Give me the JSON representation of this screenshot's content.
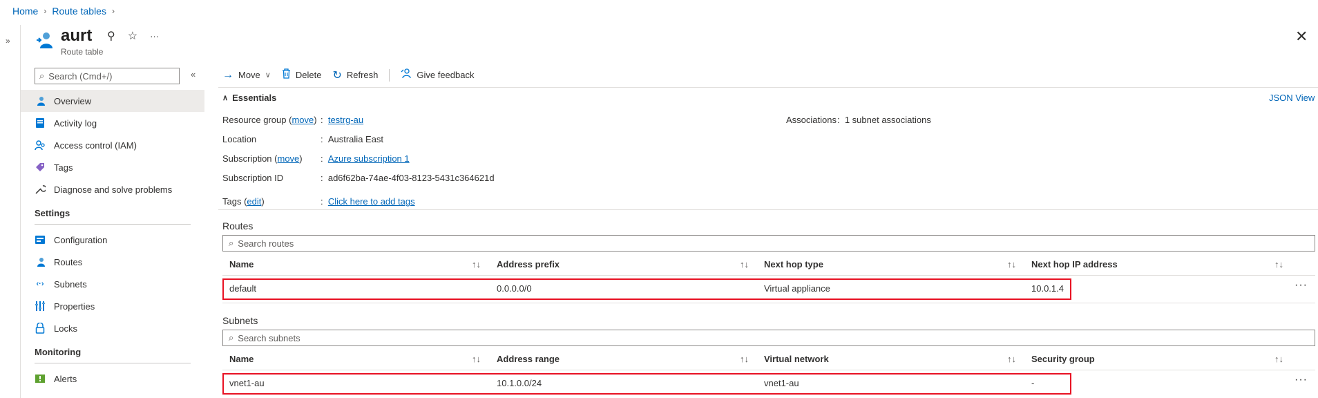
{
  "breadcrumb": {
    "home": "Home",
    "route_tables": "Route tables"
  },
  "resource": {
    "name": "aurt",
    "type": "Route table"
  },
  "menu": {
    "search_placeholder": "Search (Cmd+/)",
    "top_items": [
      "Overview",
      "Activity log",
      "Access control (IAM)",
      "Tags",
      "Diagnose and solve problems"
    ],
    "settings_label": "Settings",
    "settings_items": [
      "Configuration",
      "Routes",
      "Subnets",
      "Properties",
      "Locks"
    ],
    "monitoring_label": "Monitoring",
    "monitoring_items": [
      "Alerts"
    ]
  },
  "toolbar": {
    "move": "Move",
    "delete": "Delete",
    "refresh": "Refresh",
    "feedback": "Give feedback"
  },
  "essentials": {
    "title": "Essentials",
    "json_view": "JSON View",
    "resource_group_label": "Resource group",
    "move_link": "move",
    "resource_group_value": "testrg-au",
    "location_label": "Location",
    "location_value": "Australia East",
    "subscription_label": "Subscription",
    "subscription_value": "Azure subscription 1",
    "subscription_id_label": "Subscription ID",
    "subscription_id_value": "ad6f62ba-74ae-4f03-8123-5431c364621d",
    "tags_label": "Tags",
    "edit_link": "edit",
    "tags_value": "Click here to add tags",
    "associations_label": "Associations",
    "associations_value": "1 subnet associations"
  },
  "routes": {
    "title": "Routes",
    "search_placeholder": "Search routes",
    "columns": [
      "Name",
      "Address prefix",
      "Next hop type",
      "Next hop IP address"
    ],
    "rows": [
      [
        "default",
        "0.0.0.0/0",
        "Virtual appliance",
        "10.0.1.4"
      ]
    ]
  },
  "subnets": {
    "title": "Subnets",
    "search_placeholder": "Search subnets",
    "columns": [
      "Name",
      "Address range",
      "Virtual network",
      "Security group"
    ],
    "rows": [
      [
        "vnet1-au",
        "10.1.0.0/24",
        "vnet1-au",
        "-"
      ]
    ]
  },
  "colors": {
    "accent": "#0066b8",
    "highlight": "#e81123"
  }
}
